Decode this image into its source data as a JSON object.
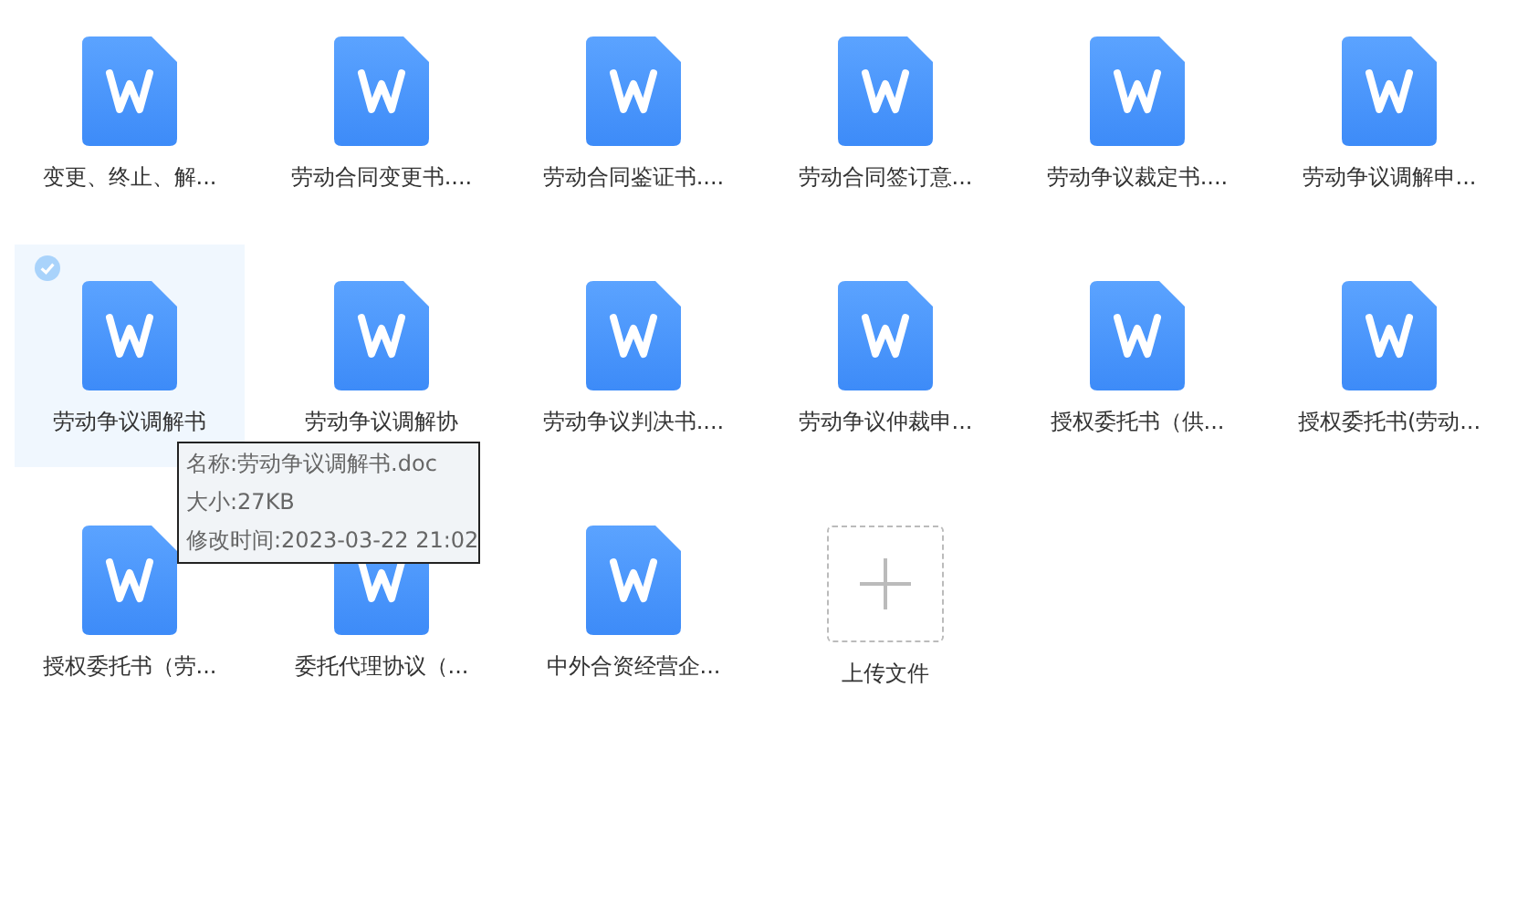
{
  "files": [
    {
      "kind": "doc",
      "name": "变更、终止、解...",
      "selected": false
    },
    {
      "kind": "doc",
      "name": "劳动合同变更书....",
      "selected": false
    },
    {
      "kind": "doc",
      "name": "劳动合同鉴证书....",
      "selected": false
    },
    {
      "kind": "doc",
      "name": "劳动合同签订意...",
      "selected": false
    },
    {
      "kind": "doc",
      "name": "劳动争议裁定书....",
      "selected": false
    },
    {
      "kind": "doc",
      "name": "劳动争议调解申...",
      "selected": false
    },
    {
      "kind": "doc",
      "name": "劳动争议调解书",
      "selected": true
    },
    {
      "kind": "doc",
      "name": "劳动争议调解协",
      "selected": false
    },
    {
      "kind": "doc",
      "name": "劳动争议判决书....",
      "selected": false
    },
    {
      "kind": "doc",
      "name": "劳动争议仲裁申...",
      "selected": false
    },
    {
      "kind": "doc",
      "name": "授权委托书（供...",
      "selected": false
    },
    {
      "kind": "doc",
      "name": "授权委托书(劳动...",
      "selected": false
    },
    {
      "kind": "doc",
      "name": "授权委托书（劳...",
      "selected": false
    },
    {
      "kind": "doc",
      "name": "委托代理协议（...",
      "selected": false
    },
    {
      "kind": "doc",
      "name": "中外合资经营企...",
      "selected": false
    },
    {
      "kind": "upload",
      "name": "上传文件"
    }
  ],
  "tooltip": {
    "lines": [
      "名称:劳动争议调解书.doc",
      "大小:27KB",
      "修改时间:2023-03-22 21:02"
    ]
  }
}
